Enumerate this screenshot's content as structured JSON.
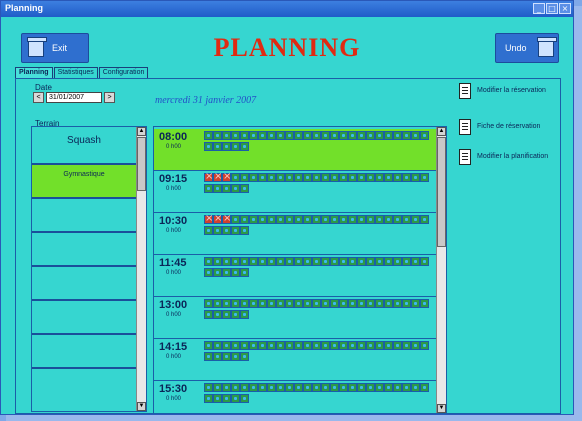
{
  "window": {
    "title": "Planning",
    "buttons": [
      "_",
      "□",
      "×"
    ]
  },
  "header": {
    "title": "PLANNING",
    "left_button_label": "Exit",
    "right_button_label": "Undo"
  },
  "tabs": [
    {
      "label": "Planning",
      "active": true
    },
    {
      "label": "Statistiques",
      "active": false
    },
    {
      "label": "Configuration",
      "active": false
    }
  ],
  "date": {
    "label": "Date",
    "value": "31/01/2007",
    "prev_symbol": "<",
    "next_symbol": ">",
    "heading": "mercredi 31 janvier 2007"
  },
  "terrains": {
    "label": "Terrain",
    "items": [
      {
        "label": "Squash",
        "selected": false
      },
      {
        "label": "Gymnastique",
        "selected": true
      },
      {
        "label": "",
        "selected": false
      },
      {
        "label": "",
        "selected": false
      },
      {
        "label": "",
        "selected": false
      },
      {
        "label": "",
        "selected": false
      },
      {
        "label": "",
        "selected": false
      }
    ]
  },
  "schedule": {
    "rows": [
      {
        "time": "08:00",
        "sub": "0 h00",
        "selected": true,
        "booked": 0
      },
      {
        "time": "09:15",
        "sub": "0 h00",
        "selected": false,
        "booked": 3
      },
      {
        "time": "10:30",
        "sub": "0 h00",
        "selected": false,
        "booked": 3
      },
      {
        "time": "11:45",
        "sub": "0 h00",
        "selected": false,
        "booked": 0
      },
      {
        "time": "13:00",
        "sub": "0 h00",
        "selected": false,
        "booked": 0
      },
      {
        "time": "14:15",
        "sub": "0 h00",
        "selected": false,
        "booked": 0
      },
      {
        "time": "15:30",
        "sub": "0 h00",
        "selected": false,
        "booked": 0
      }
    ]
  },
  "side_actions": [
    {
      "label": "Modifier la réservation"
    },
    {
      "label": "Fiche de réservation"
    },
    {
      "label": "Modifier la planification"
    }
  ],
  "colors": {
    "background": "#36d6d0",
    "title": "#e02a12",
    "selected_row": "#72e02a",
    "booked_slot": "#d0412e"
  }
}
